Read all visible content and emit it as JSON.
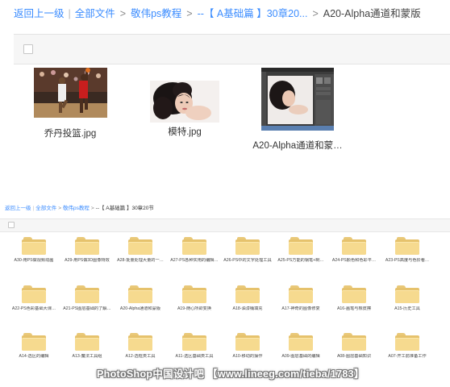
{
  "top": {
    "breadcrumb": {
      "back": "返回上一级",
      "all_files": "全部文件",
      "level1": "敬伟ps教程",
      "level2": "--【 A基础篇 】30章20...",
      "current": "A20-Alpha通道和蒙版"
    },
    "files": [
      {
        "name": "乔丹投篮.jpg",
        "icon": "basketball-photo"
      },
      {
        "name": "模特.jpg",
        "icon": "model-portrait-photo"
      },
      {
        "name": "A20-Alpha通道和蒙…",
        "icon": "photoshop-screenshot"
      }
    ]
  },
  "bottom": {
    "breadcrumb": {
      "back": "返回上一级",
      "all_files": "全部文件",
      "level1": "敬伟ps教程",
      "level2": "--【 A基础篇 】30章20节"
    },
    "folders": [
      "A30-用PS做视频动画",
      "A29-用PS做3D图像特效",
      "A28-批量处理大量的一…",
      "A27-PS各种实用的编辑…",
      "A26-PS中的文字处理工具",
      "A25-PS万能的钢笔+制…",
      "A24-PS颜色和色彩平…",
      "A23-PS高度与色阶看…",
      "A22-PS色彩基础大课…",
      "A21-PS图层基础的了解…",
      "A20-Alpha通道和蒙版",
      "A19-随心所欲变换",
      "A18-油漆桶填充",
      "A17-神奇的图像修复",
      "A16-画笔与橡皮擦",
      "A15-历史工具",
      "A14-选区的编辑",
      "A13-魔法工具组",
      "A12-选框类工具",
      "A11-选区基础类工具",
      "A10-移动的操作",
      "A09-图层基础的编辑",
      "A08-图层基础知识",
      "A07-开工前准备工作"
    ]
  },
  "watermark": "PhotoShop中国设计吧 【www.lineeg.com/tieba/1783】"
}
